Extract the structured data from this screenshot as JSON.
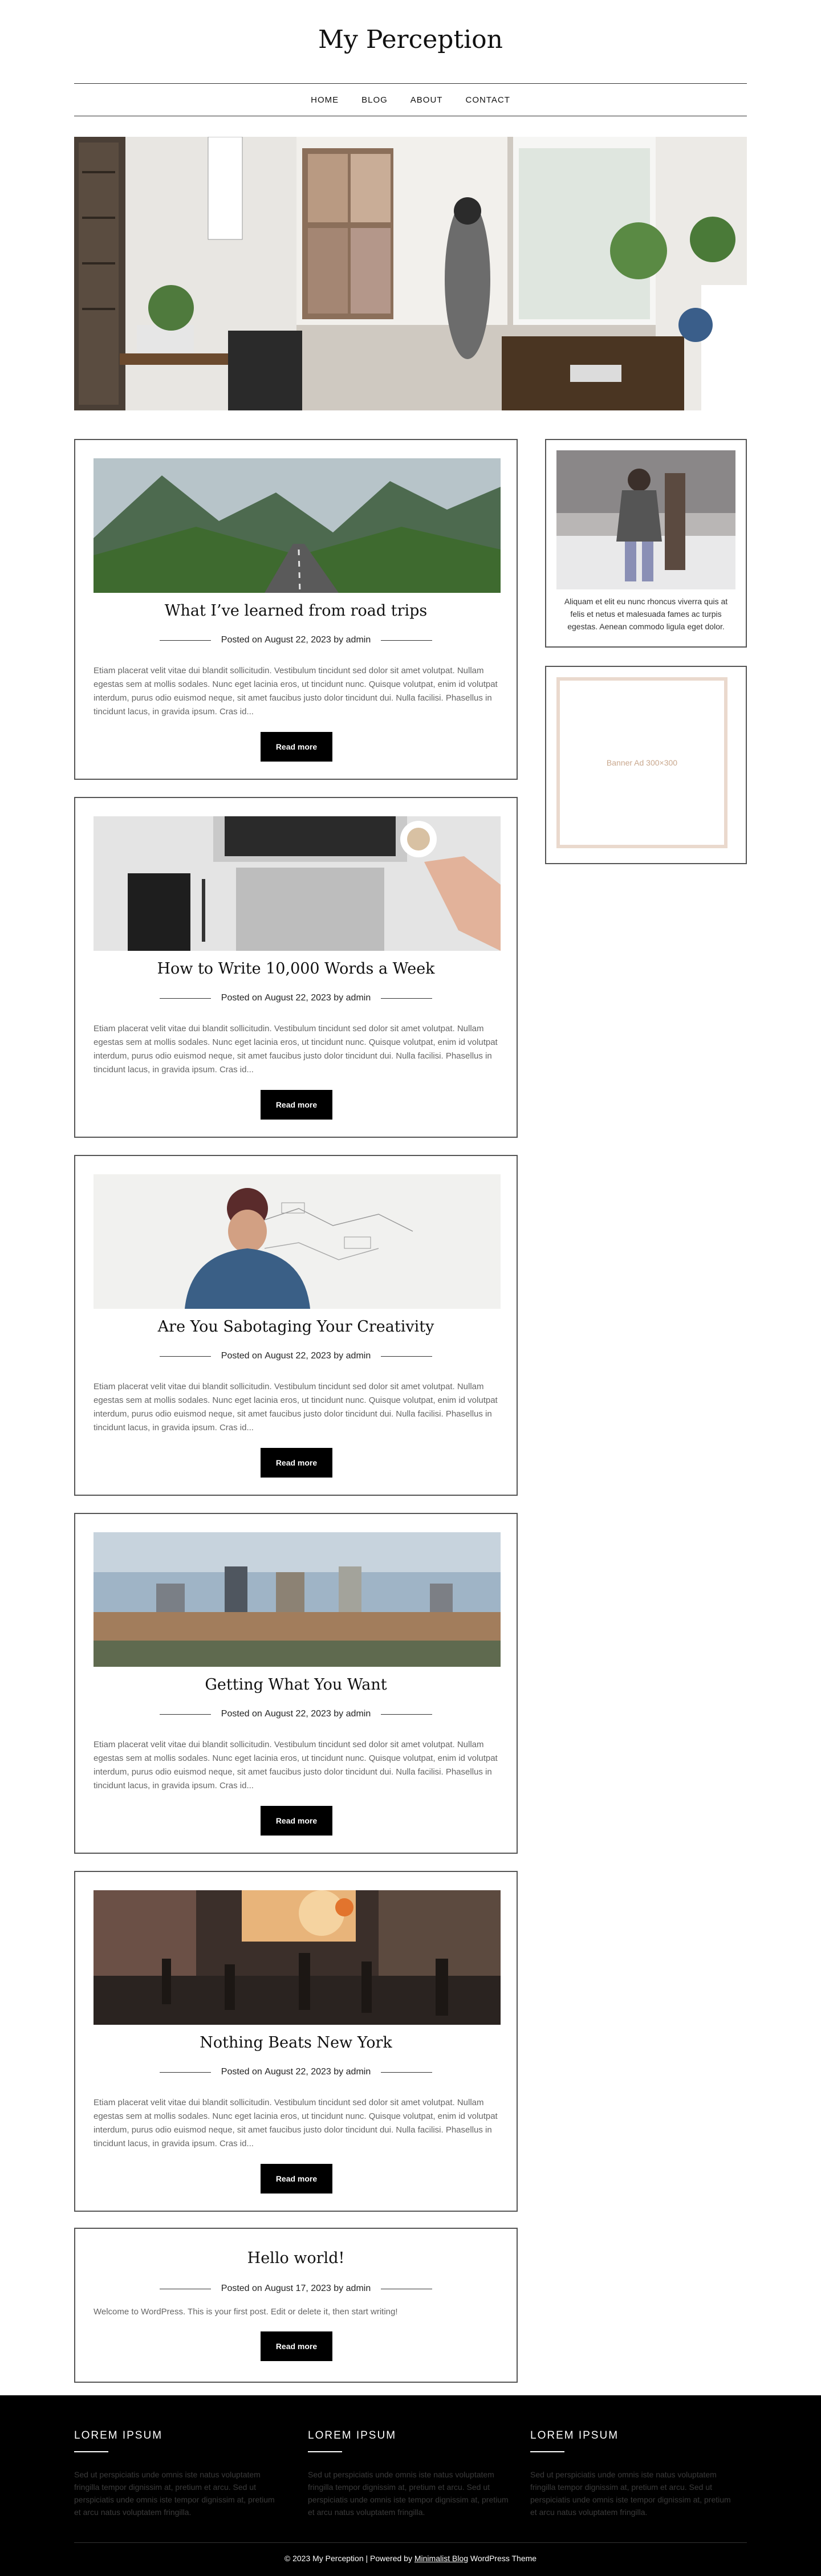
{
  "site": {
    "title": "My Perception"
  },
  "nav": {
    "items": [
      "HOME",
      "BLOG",
      "ABOUT",
      "CONTACT"
    ]
  },
  "posts": [
    {
      "title": "What I’ve learned from road trips",
      "meta_prefix": "Posted on",
      "date": "August 22, 2023",
      "by": "by",
      "author": "admin",
      "excerpt": "Etiam placerat velit vitae dui blandit sollicitudin. Vestibulum tincidunt sed dolor sit amet volutpat. Nullam egestas sem at mollis sodales. Nunc eget lacinia eros, ut tincidunt nunc. Quisque volutpat, enim id volutpat interdum, purus odio euismod neque, sit amet faucibus justo dolor tincidunt dui. Nulla facilisi. Phasellus in tincidunt lacus, in gravida ipsum. Cras id...",
      "button": "Read more"
    },
    {
      "title": "How to Write 10,000 Words a Week",
      "meta_prefix": "Posted on",
      "date": "August 22, 2023",
      "by": "by",
      "author": "admin",
      "excerpt": "Etiam placerat velit vitae dui blandit sollicitudin. Vestibulum tincidunt sed dolor sit amet volutpat. Nullam egestas sem at mollis sodales. Nunc eget lacinia eros, ut tincidunt nunc. Quisque volutpat, enim id volutpat interdum, purus odio euismod neque, sit amet faucibus justo dolor tincidunt dui. Nulla facilisi. Phasellus in tincidunt lacus, in gravida ipsum. Cras id...",
      "button": "Read more"
    },
    {
      "title": "Are You Sabotaging Your Creativity",
      "meta_prefix": "Posted on",
      "date": "August 22, 2023",
      "by": "by",
      "author": "admin",
      "excerpt": "Etiam placerat velit vitae dui blandit sollicitudin. Vestibulum tincidunt sed dolor sit amet volutpat. Nullam egestas sem at mollis sodales. Nunc eget lacinia eros, ut tincidunt nunc. Quisque volutpat, enim id volutpat interdum, purus odio euismod neque, sit amet faucibus justo dolor tincidunt dui. Nulla facilisi. Phasellus in tincidunt lacus, in gravida ipsum. Cras id...",
      "button": "Read more"
    },
    {
      "title": "Getting What You Want",
      "meta_prefix": "Posted on",
      "date": "August 22, 2023",
      "by": "by",
      "author": "admin",
      "excerpt": "Etiam placerat velit vitae dui blandit sollicitudin. Vestibulum tincidunt sed dolor sit amet volutpat. Nullam egestas sem at mollis sodales. Nunc eget lacinia eros, ut tincidunt nunc. Quisque volutpat, enim id volutpat interdum, purus odio euismod neque, sit amet faucibus justo dolor tincidunt dui. Nulla facilisi. Phasellus in tincidunt lacus, in gravida ipsum. Cras id...",
      "button": "Read more"
    },
    {
      "title": "Nothing Beats New York",
      "meta_prefix": "Posted on",
      "date": "August 22, 2023",
      "by": "by",
      "author": "admin",
      "excerpt": "Etiam placerat velit vitae dui blandit sollicitudin. Vestibulum tincidunt sed dolor sit amet volutpat. Nullam egestas sem at mollis sodales. Nunc eget lacinia eros, ut tincidunt nunc. Quisque volutpat, enim id volutpat interdum, purus odio euismod neque, sit amet faucibus justo dolor tincidunt dui. Nulla facilisi. Phasellus in tincidunt lacus, in gravida ipsum. Cras id...",
      "button": "Read more"
    },
    {
      "title": "Hello world!",
      "meta_prefix": "Posted on",
      "date": "August 17, 2023",
      "by": "by",
      "author": "admin",
      "excerpt": "Welcome to WordPress. This is your first post. Edit or delete it, then start writing!",
      "button": "Read more"
    }
  ],
  "sidebar": {
    "about_text": "Aliquam et elit eu nunc rhoncus viverra quis at felis et netus et malesuada fames ac turpis egestas. Aenean commodo ligula eget dolor.",
    "banner_text": "Banner Ad 300×300",
    "banner_color": "#c9a88e"
  },
  "footer": {
    "columns": [
      {
        "title": "LOREM IPSUM",
        "text": "Sed ut perspiciatis unde omnis iste natus voluptatem fringilla tempor dignissim at, pretium et arcu. Sed ut perspiciatis unde omnis iste tempor dignissim at, pretium et arcu natus voluptatem fringilla."
      },
      {
        "title": "LOREM IPSUM",
        "text": "Sed ut perspiciatis unde omnis iste natus voluptatem fringilla tempor dignissim at, pretium et arcu. Sed ut perspiciatis unde omnis iste tempor dignissim at, pretium et arcu natus voluptatem fringilla."
      },
      {
        "title": "LOREM IPSUM",
        "text": "Sed ut perspiciatis unde omnis iste natus voluptatem fringilla tempor dignissim at, pretium et arcu. Sed ut perspiciatis unde omnis iste tempor dignissim at, pretium et arcu natus voluptatem fringilla."
      }
    ],
    "copyright_prefix": "© 2023 My Perception | Powered by",
    "theme_link": "Minimalist Blog",
    "copyright_suffix": "WordPress Theme"
  }
}
